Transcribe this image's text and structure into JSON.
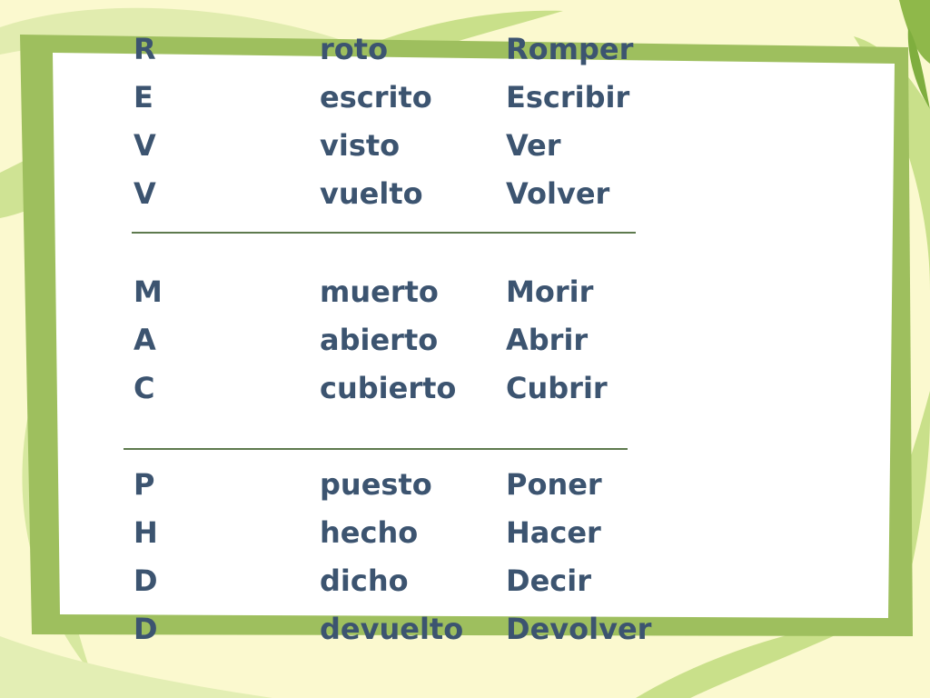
{
  "groups": [
    {
      "rows": [
        {
          "letter": "R",
          "participle": "roto",
          "infinitive": "Romper"
        },
        {
          "letter": "E",
          "participle": "escrito",
          "infinitive": "Escribir"
        },
        {
          "letter": "V",
          "participle": "visto",
          "infinitive": "Ver"
        },
        {
          "letter": "V",
          "participle": "vuelto",
          "infinitive": "Volver"
        }
      ]
    },
    {
      "rows": [
        {
          "letter": "M",
          "participle": "muerto",
          "infinitive": "Morir"
        },
        {
          "letter": "A",
          "participle": "abierto",
          "infinitive": "Abrir"
        },
        {
          "letter": "C",
          "participle": "cubierto",
          "infinitive": "Cubrir"
        }
      ]
    },
    {
      "rows": [
        {
          "letter": "P",
          "participle": "puesto",
          "infinitive": "Poner"
        },
        {
          "letter": "H",
          "participle": "hecho",
          "infinitive": "Hacer"
        },
        {
          "letter": "D",
          "participle": "dicho",
          "infinitive": "Decir"
        },
        {
          "letter": "D",
          "participle": "devuelto",
          "infinitive": "Devolver"
        }
      ]
    }
  ],
  "colors": {
    "background": "#fbf9cf",
    "frame": "#9ebf5e",
    "swirl": "#c9e08a",
    "text": "#3c5470",
    "divider": "#5e7a4e"
  }
}
